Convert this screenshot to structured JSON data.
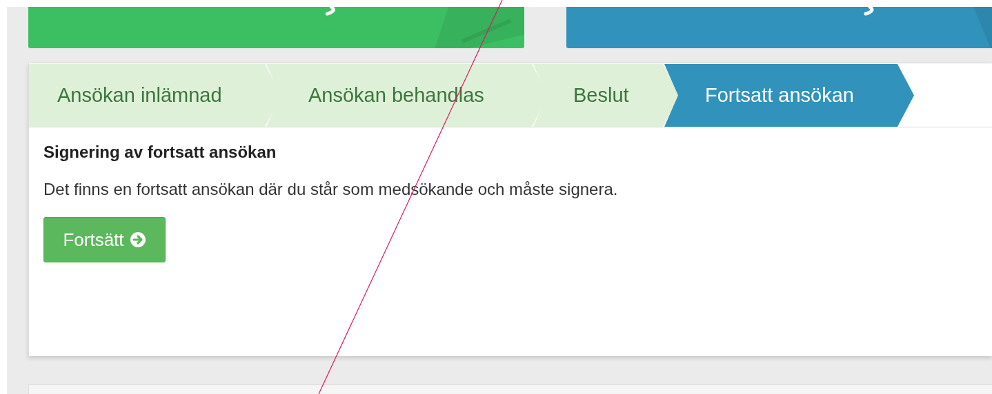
{
  "steps": [
    {
      "label": "Ansökan inlämnad",
      "selected": false
    },
    {
      "label": "Ansökan behandlas",
      "selected": false
    },
    {
      "label": "Beslut",
      "selected": false
    },
    {
      "label": "Fortsatt ansökan",
      "selected": true
    }
  ],
  "heading": "Signering av fortsatt ansökan",
  "message": "Det finns en fortsatt ansökan där du står som medsökande och måste signera.",
  "button": {
    "label": "Fortsätt"
  }
}
